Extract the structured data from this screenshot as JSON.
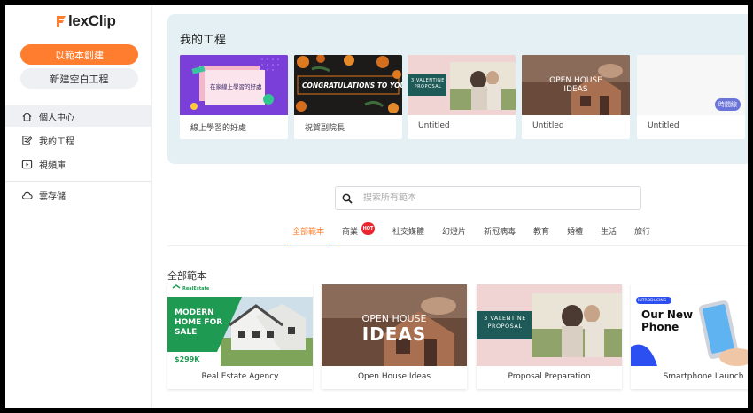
{
  "app": {
    "logo_text": "lexClip"
  },
  "sidebar": {
    "create_from_template": "以範本創建",
    "new_blank_project": "新建空白工程",
    "items": [
      {
        "label": "個人中心",
        "icon": "home-icon",
        "active": true
      },
      {
        "label": "我的工程",
        "icon": "edit-icon",
        "active": false
      },
      {
        "label": "視頻庫",
        "icon": "video-icon",
        "active": false
      },
      {
        "label": "雲存儲",
        "icon": "cloud-icon",
        "active": false
      }
    ]
  },
  "projects": {
    "title": "我的工程",
    "cards": [
      {
        "label": "線上學習的好處",
        "thumb_text": "在家線上學習的好處"
      },
      {
        "label": "祝賀副院長",
        "thumb_text": "CONGRATULATIONS TO YOU!"
      },
      {
        "label": "Untitled",
        "thumb_text": "3 VALENTINE PROPOSAL"
      },
      {
        "label": "Untitled",
        "thumb_text": "OPEN HOUSE IDEAS"
      },
      {
        "label": "Untitled",
        "badge": "時間線"
      }
    ]
  },
  "search": {
    "placeholder": "搜索所有範本"
  },
  "tabs": [
    {
      "label": "全部範本",
      "active": true
    },
    {
      "label": "商業",
      "badge": "HOT"
    },
    {
      "label": "社交媒體"
    },
    {
      "label": "幻燈片"
    },
    {
      "label": "新冠病毒"
    },
    {
      "label": "教育"
    },
    {
      "label": "婚禮"
    },
    {
      "label": "生活"
    },
    {
      "label": "旅行"
    }
  ],
  "templates": {
    "title": "全部範本",
    "cards": [
      {
        "label": "Real Estate Agency",
        "brand": "RealEstate",
        "headline": "MODERN HOME FOR SALE",
        "price": "$299K"
      },
      {
        "label": "Open House Ideas",
        "line1": "OPEN HOUSE",
        "line2": "IDEAS"
      },
      {
        "label": "Proposal Preparation",
        "headline": "3 VALENTINE PROPOSAL"
      },
      {
        "label": "Smartphone Launch",
        "tag": "INTRODUCING",
        "headline": "Our New Phone"
      }
    ]
  },
  "colors": {
    "accent": "#ff7d2e",
    "panel": "#e4f0f4",
    "hot": "#e8262d"
  }
}
